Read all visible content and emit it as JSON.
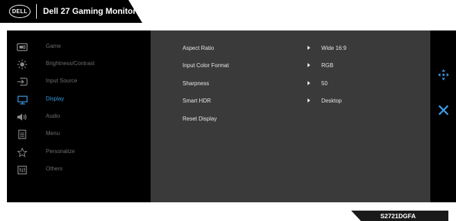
{
  "header": {
    "logo_text": "DELL",
    "title": "Dell 27 Gaming Monitor"
  },
  "sidebar": {
    "items": [
      {
        "label": "Game",
        "icon": "game-icon",
        "active": false
      },
      {
        "label": "Brightness/Contrast",
        "icon": "brightness-icon",
        "active": false
      },
      {
        "label": "Input Source",
        "icon": "input-source-icon",
        "active": false
      },
      {
        "label": "Display",
        "icon": "display-icon",
        "active": true
      },
      {
        "label": "Audio",
        "icon": "audio-icon",
        "active": false
      },
      {
        "label": "Menu",
        "icon": "menu-icon",
        "active": false
      },
      {
        "label": "Personalize",
        "icon": "star-icon",
        "active": false
      },
      {
        "label": "Others",
        "icon": "others-icon",
        "active": false
      }
    ]
  },
  "content": {
    "rows": [
      {
        "label": "Aspect Ratio",
        "has_arrow": true,
        "value": "Wide 16:9"
      },
      {
        "label": "Input Color Format",
        "has_arrow": true,
        "value": "RGB"
      },
      {
        "label": "Sharpness",
        "has_arrow": true,
        "value": "50"
      },
      {
        "label": "Smart HDR",
        "has_arrow": true,
        "value": "Desktop"
      },
      {
        "label": "Reset Display",
        "has_arrow": false,
        "value": ""
      }
    ]
  },
  "rightbar": {
    "nav_icon": "navigation-arrows-icon",
    "close_icon": "close-icon"
  },
  "footer": {
    "model": "S2721DGFA"
  },
  "colors": {
    "accent": "#3a98e0",
    "panel": "#000000",
    "content_bg": "#3a3a3a",
    "inactive_text": "#6e6e6e"
  }
}
